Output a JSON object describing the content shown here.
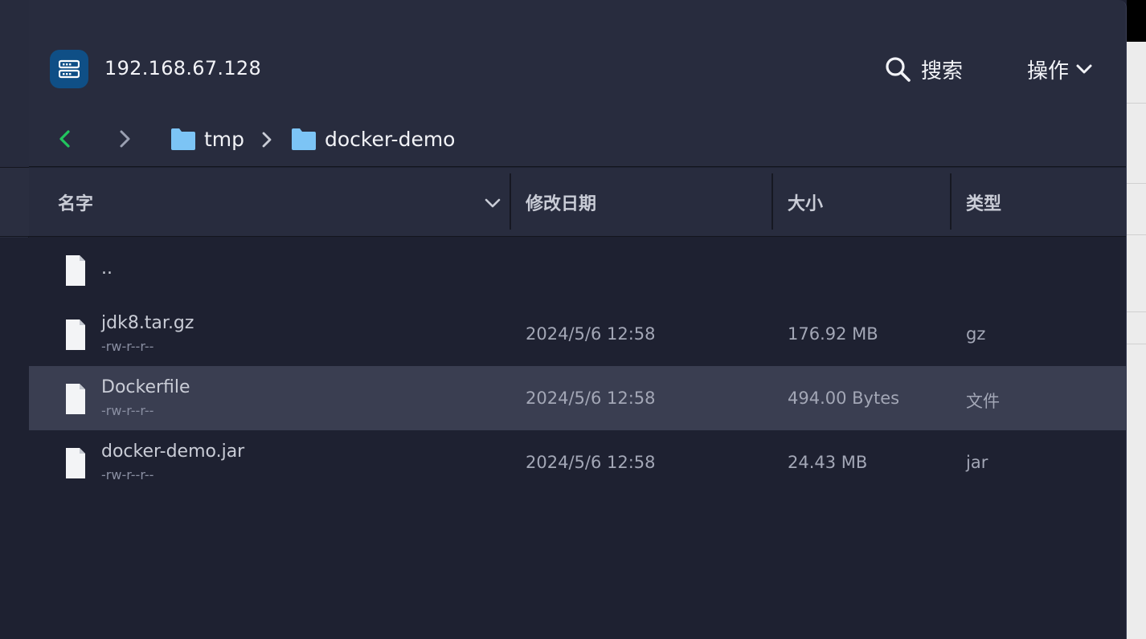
{
  "header": {
    "host": "192.168.67.128",
    "search_label": "搜索",
    "ops_label": "操作"
  },
  "breadcrumb": {
    "items": [
      "tmp",
      "docker-demo"
    ]
  },
  "columns": {
    "name": "名字",
    "modified": "修改日期",
    "size": "大小",
    "type": "类型"
  },
  "files": [
    {
      "name": "..",
      "perm": "",
      "modified": "",
      "size": "",
      "type": ""
    },
    {
      "name": "jdk8.tar.gz",
      "perm": "-rw-r--r--",
      "modified": "2024/5/6 12:58",
      "size": "176.92 MB",
      "type": "gz"
    },
    {
      "name": "Dockerfile",
      "perm": "-rw-r--r--",
      "modified": "2024/5/6 12:58",
      "size": "494.00 Bytes",
      "type": "文件"
    },
    {
      "name": "docker-demo.jar",
      "perm": "-rw-r--r--",
      "modified": "2024/5/6 12:58",
      "size": "24.43 MB",
      "type": "jar"
    }
  ],
  "selected_row": 2,
  "colors": {
    "accent_back": "#22c55e",
    "folder": "#7cc4f5",
    "server_icon_bg": "#0f4f86"
  }
}
